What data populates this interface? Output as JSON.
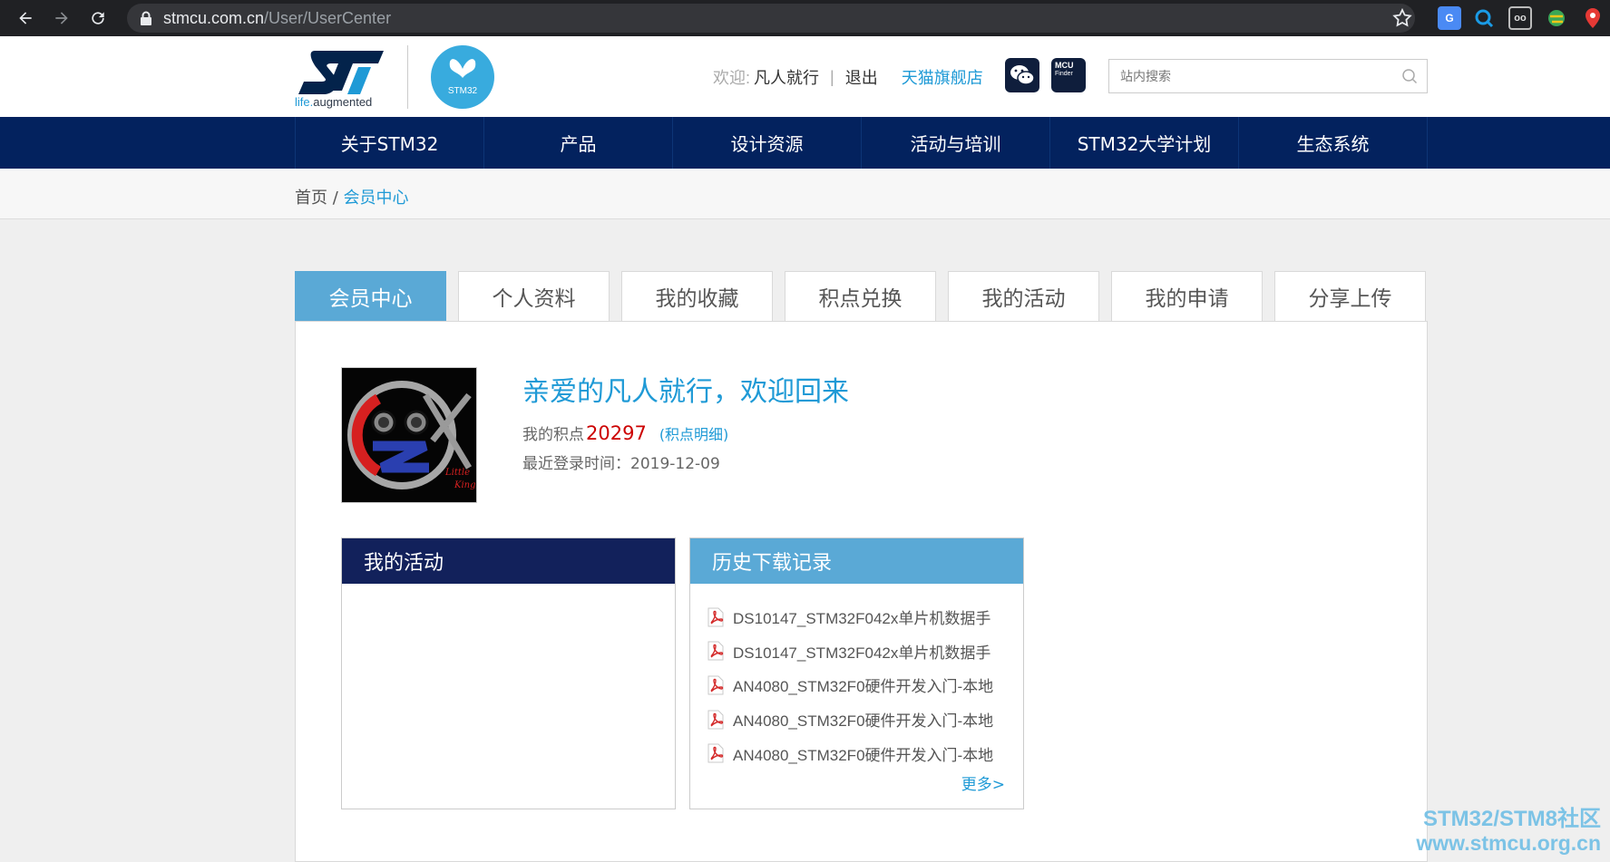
{
  "browser": {
    "url_host": "stmcu.com.cn",
    "url_path": "/User/UserCenter"
  },
  "header": {
    "st_tagline_a": "life.",
    "st_tagline_b": "augmented",
    "stm32_logo_text": "STM32",
    "welcome_label": "欢迎:",
    "username": "凡人就行",
    "separator": "|",
    "logout": "退出",
    "tmall_store": "天猫旗舰店",
    "mcu_badge_line1": "MCU",
    "mcu_badge_line2": "Finder",
    "search_placeholder": "站内搜索"
  },
  "nav": {
    "items": [
      "关于STM32",
      "产品",
      "设计资源",
      "活动与培训",
      "STM32大学计划",
      "生态系统"
    ]
  },
  "breadcrumb": {
    "home": "首页",
    "separator": "/",
    "current": "会员中心"
  },
  "tabs": [
    "会员中心",
    "个人资料",
    "我的收藏",
    "积点兑换",
    "我的活动",
    "我的申请",
    "分享上传"
  ],
  "profile": {
    "greeting": "亲爱的凡人就行，欢迎回来",
    "points_label": "我的积点",
    "points_value": "20297",
    "points_detail": "(积点明细)",
    "last_login": "最近登录时间：2019-12-09",
    "avatar_text": "Little King"
  },
  "activities": {
    "title": "我的活动"
  },
  "downloads": {
    "title": "历史下载记录",
    "items": [
      "DS10147_STM32F042x单片机数据手",
      "DS10147_STM32F042x单片机数据手",
      "AN4080_STM32F0硬件开发入门-本地",
      "AN4080_STM32F0硬件开发入门-本地",
      "AN4080_STM32F0硬件开发入门-本地"
    ],
    "more": "更多>"
  },
  "watermark": {
    "line1": "STM32/STM8社区",
    "line2": "www.stmcu.org.cn"
  },
  "colors": {
    "nav_bg": "#03225e",
    "accent_blue": "#1f9ad6",
    "tab_active": "#5aa9d6",
    "points_red": "#cc0000"
  }
}
